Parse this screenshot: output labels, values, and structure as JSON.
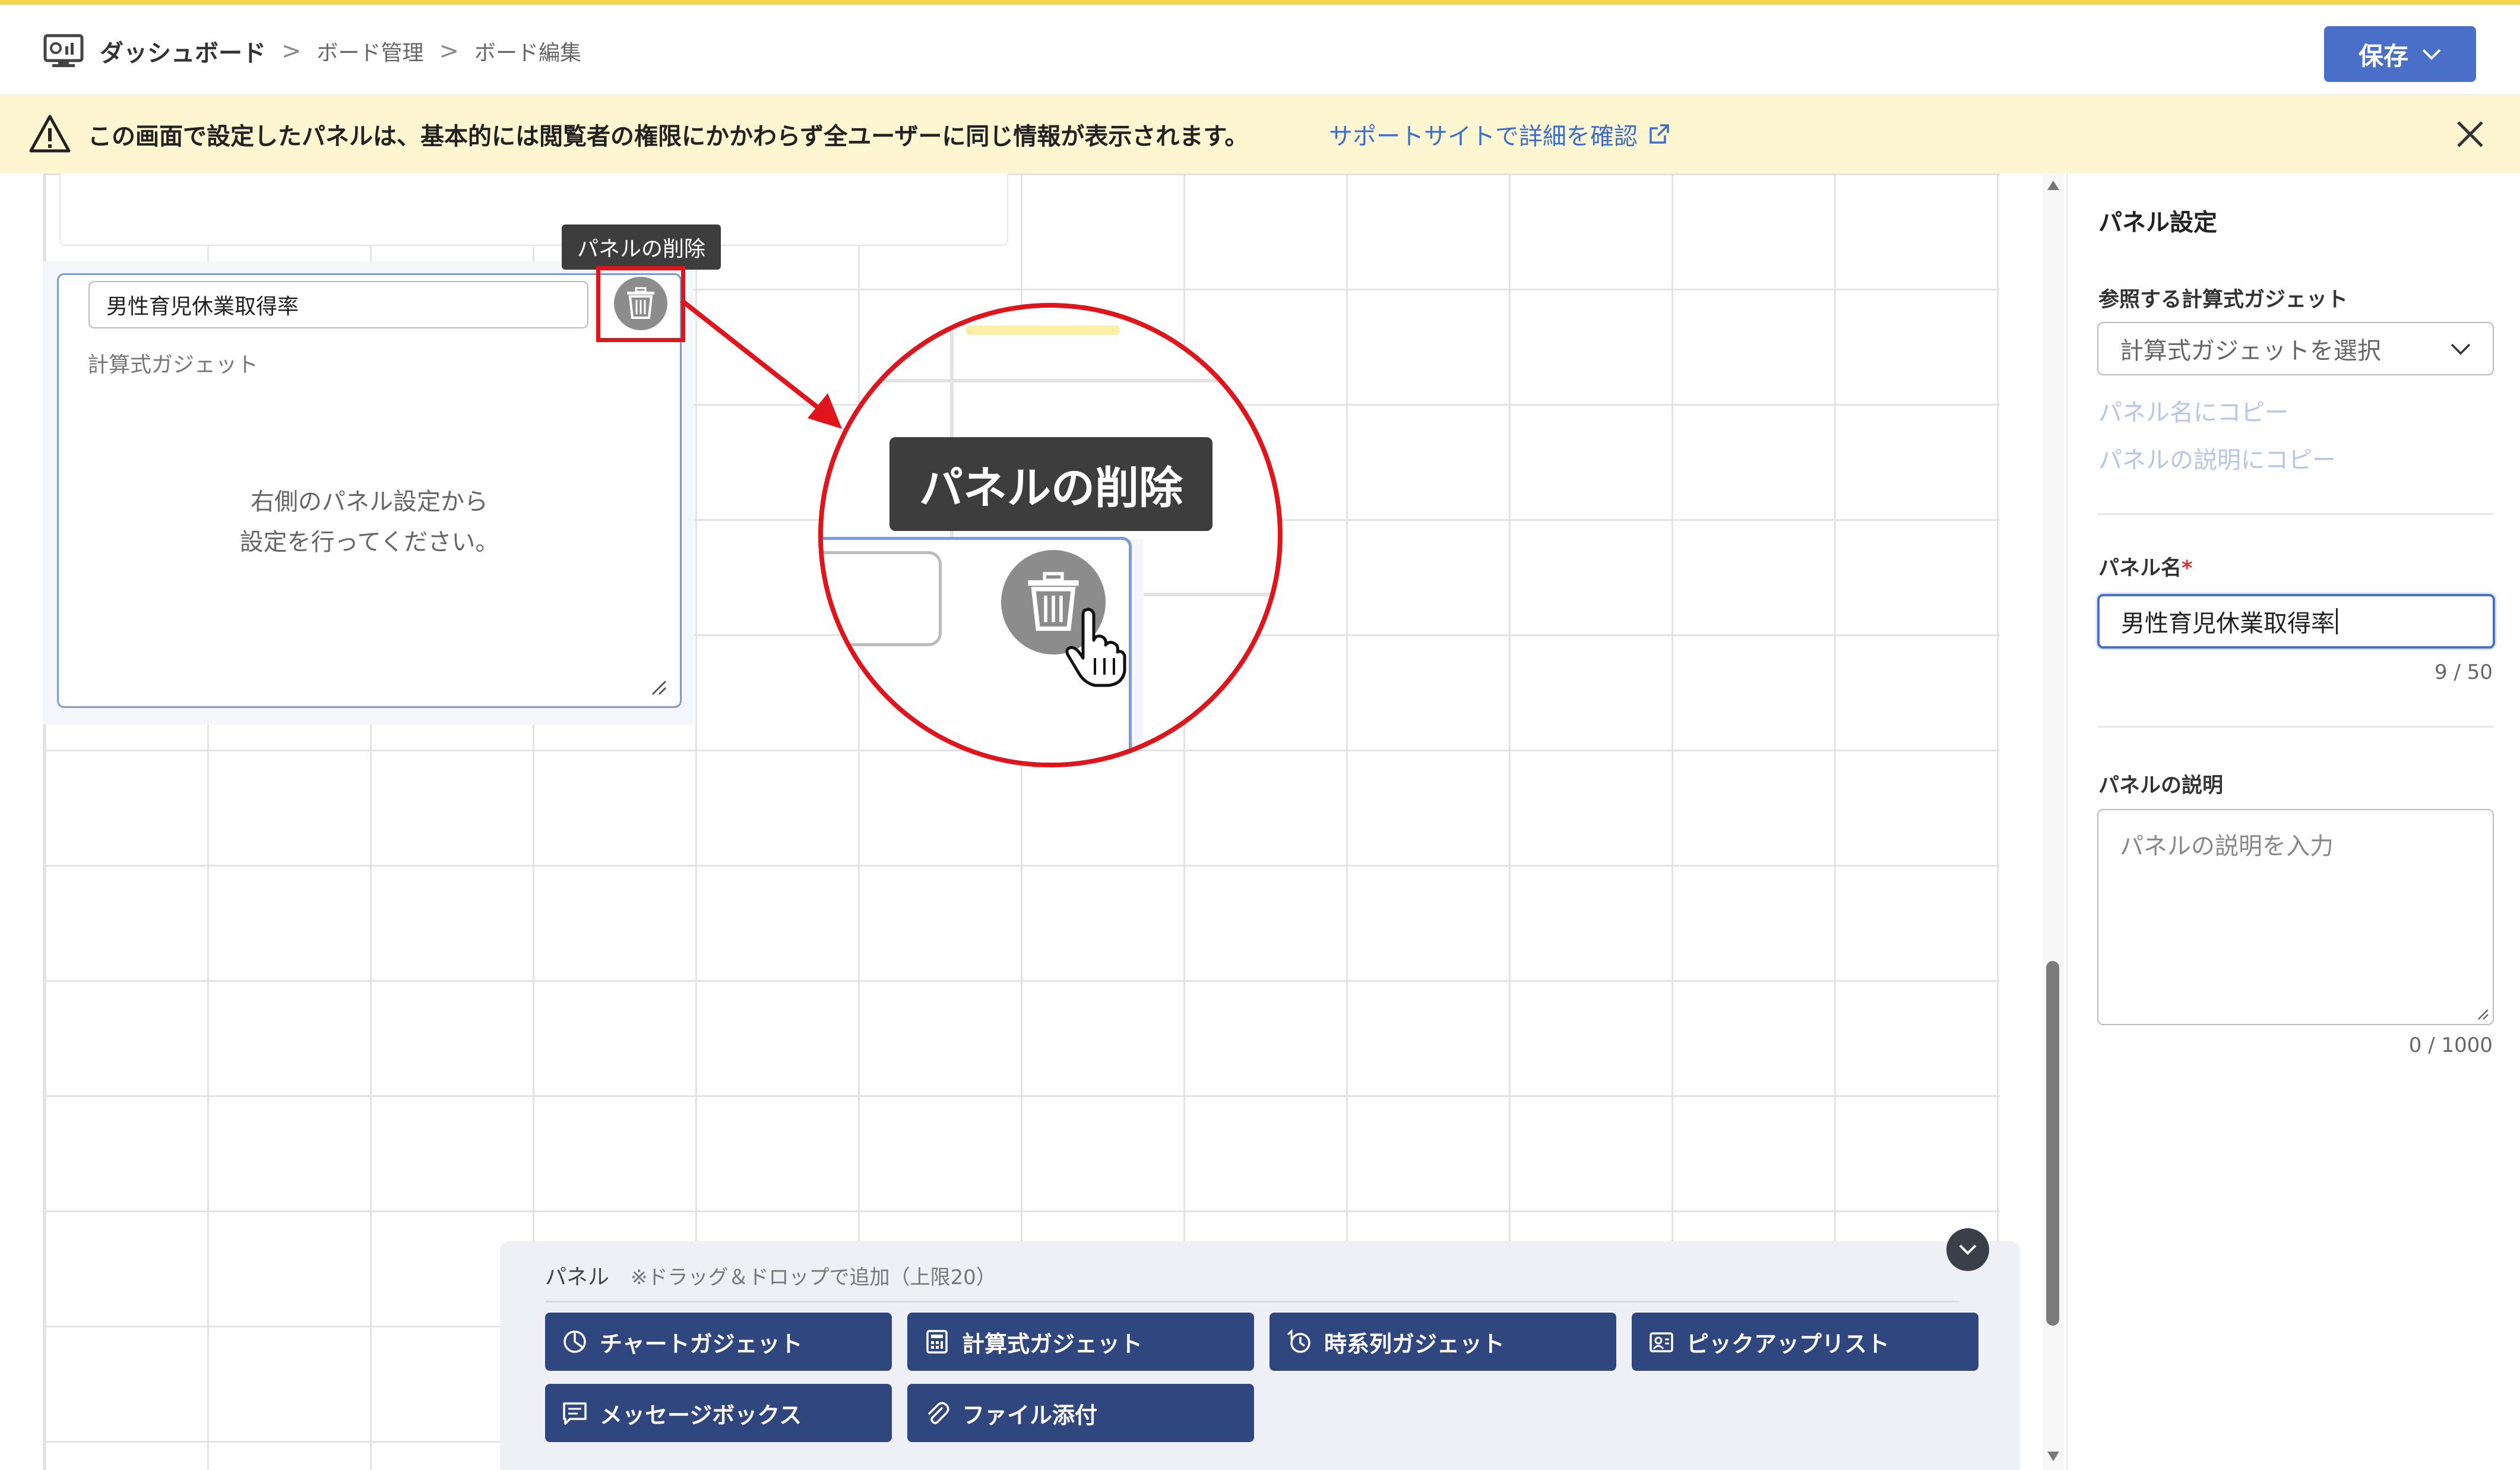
{
  "header": {
    "breadcrumb_root": "ダッシュボード",
    "breadcrumb_sep": ">",
    "breadcrumb_items": [
      "ボード管理",
      "ボード編集"
    ],
    "save_label": "保存"
  },
  "notice": {
    "text": "この画面で設定したパネルは、基本的には閲覧者の権限にかかわらず全ユーザーに同じ情報が表示されます。",
    "link_label": "サポートサイトで詳細を確認"
  },
  "canvas_panel": {
    "name_value": "男性育児休業取得率",
    "type_label": "計算式ガジェット",
    "message_line1": "右側のパネル設定から",
    "message_line2": "設定を行ってください。",
    "tooltip": "パネルの削除"
  },
  "zoom": {
    "tooltip": "パネルの削除"
  },
  "palette": {
    "title": "パネル",
    "note": "※ドラッグ＆ドロップで追加（上限20）",
    "buttons": [
      {
        "label": "チャートガジェット",
        "icon": "pie-chart-icon"
      },
      {
        "label": "計算式ガジェット",
        "icon": "calculator-icon"
      },
      {
        "label": "時系列ガジェット",
        "icon": "time-series-icon"
      },
      {
        "label": "ピックアップリスト",
        "icon": "pickup-list-icon"
      },
      {
        "label": "メッセージボックス",
        "icon": "message-box-icon"
      },
      {
        "label": "ファイル添付",
        "icon": "paperclip-icon"
      }
    ]
  },
  "settings": {
    "title": "パネル設定",
    "ref_gadget_label": "参照する計算式ガジェット",
    "ref_gadget_placeholder": "計算式ガジェットを選択",
    "copy_to_name": "パネル名にコピー",
    "copy_to_desc": "パネルの説明にコピー",
    "name_label": "パネル名",
    "required_mark": "*",
    "name_value": "男性育児休業取得率",
    "name_count": "9 / 50",
    "desc_label": "パネルの説明",
    "desc_placeholder": "パネルの説明を入力",
    "desc_count": "0 / 1000"
  },
  "colors": {
    "primary": "#4a6fc9",
    "gadget_button": "#2f467e",
    "notice_bg": "#fdf6d0",
    "callout_red": "#e0141a"
  }
}
